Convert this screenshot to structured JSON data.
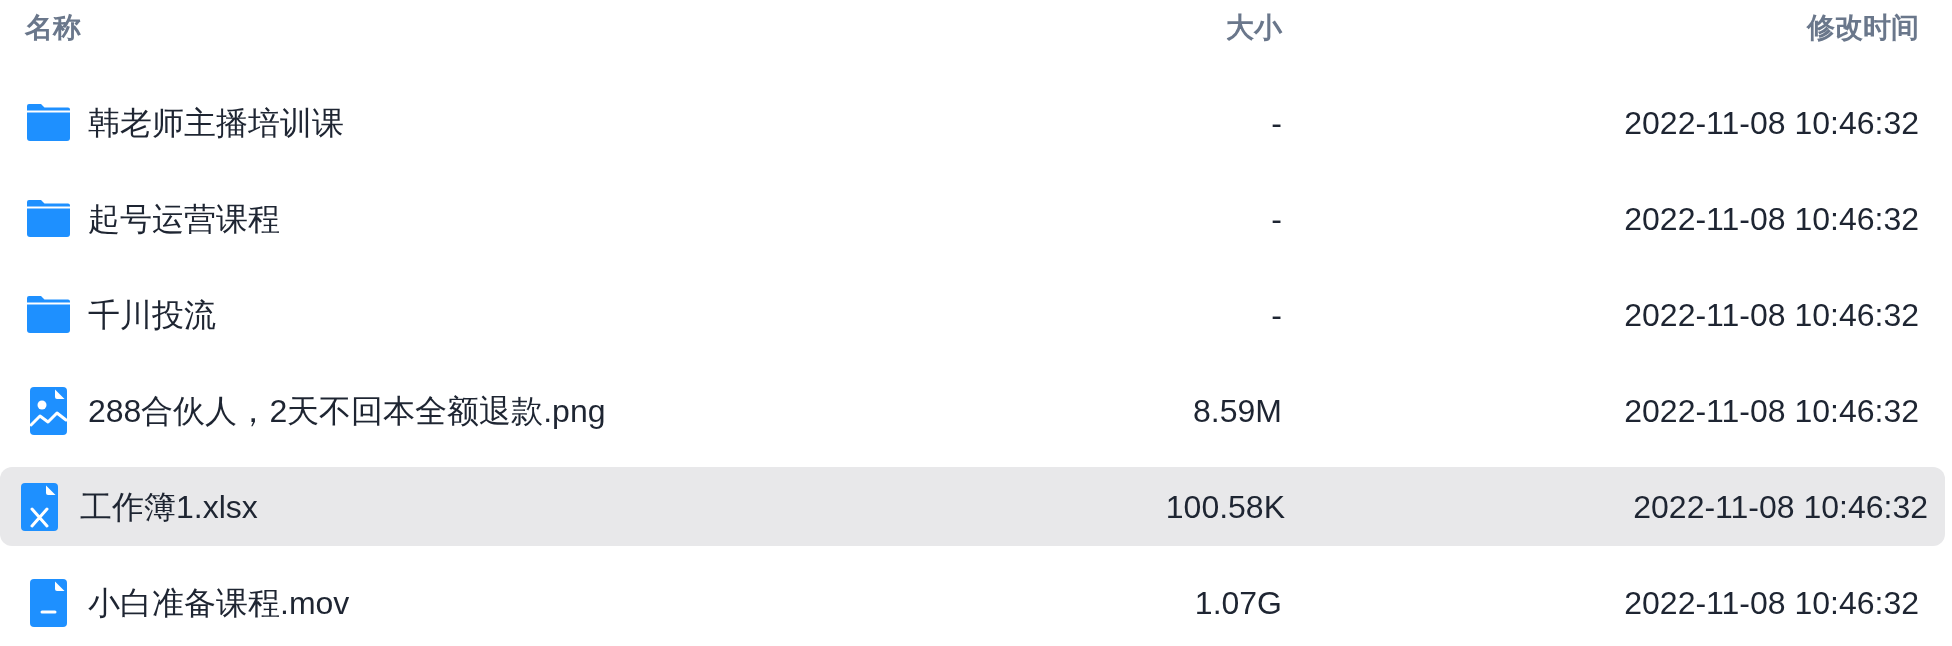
{
  "columns": [
    {
      "label": "名称"
    },
    {
      "label": "大小"
    },
    {
      "label": "修改时间"
    }
  ],
  "rows": [
    {
      "kind": "folder",
      "name": "韩老师主播培训课",
      "size": "-",
      "modified": "2022-11-08 10:46:32",
      "selected": false
    },
    {
      "kind": "folder",
      "name": "起号运营课程",
      "size": "-",
      "modified": "2022-11-08 10:46:32",
      "selected": false
    },
    {
      "kind": "folder",
      "name": "千川投流",
      "size": "-",
      "modified": "2022-11-08 10:46:32",
      "selected": false
    },
    {
      "kind": "image",
      "name": "288合伙人，2天不回本全额退款.png",
      "size": "8.59M",
      "modified": "2022-11-08 10:46:32",
      "selected": false
    },
    {
      "kind": "spreadsheet",
      "name": "工作簿1.xlsx",
      "size": "100.58K",
      "modified": "2022-11-08 10:46:32",
      "selected": true
    },
    {
      "kind": "document",
      "name": "小白准备课程.mov",
      "size": "1.07G",
      "modified": "2022-11-08 10:46:32",
      "selected": false
    }
  ]
}
